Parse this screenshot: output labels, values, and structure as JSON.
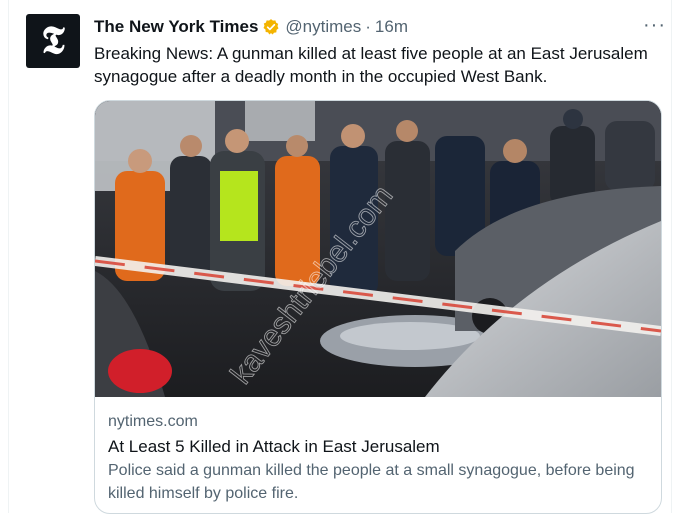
{
  "account": {
    "name": "The New York Times",
    "handle": "@nytimes",
    "separator": "·",
    "time": "16m",
    "avatar_icon": "nyt-t-logo",
    "avatar_glyph": "𝕿"
  },
  "tweet": {
    "text": "Breaking News: A gunman killed at least five people at an East Jerusalem synagogue after a deadly month in the occupied West Bank.",
    "more_icon": "···"
  },
  "card": {
    "domain": "nytimes.com",
    "title": "At Least 5 Killed in Attack in East Jerusalem",
    "description": "Police said a gunman killed the people at a small synagogue, before being killed himself by police fire.",
    "image_watermark": "kaveshtriebel.com"
  },
  "colors": {
    "verified": "#f4b400",
    "secondary_text": "#536471",
    "border": "#cfd9de"
  }
}
